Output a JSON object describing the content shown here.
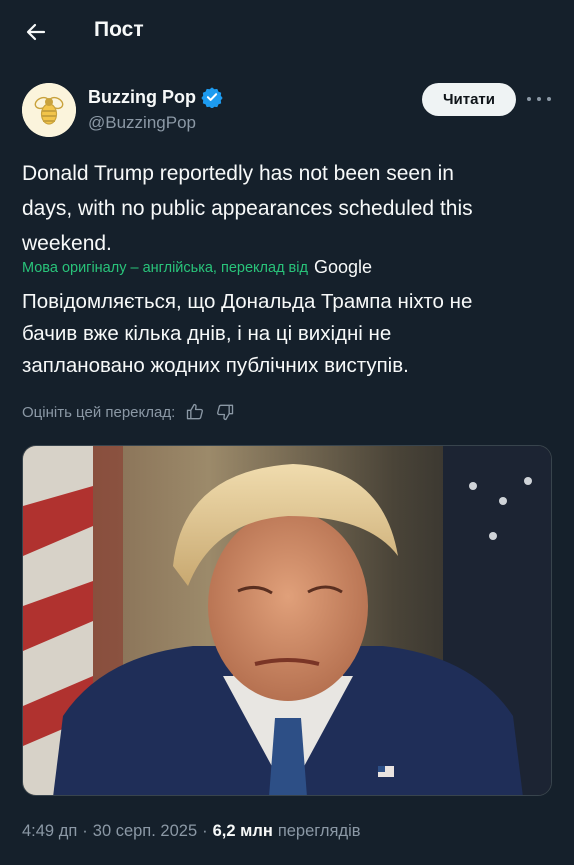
{
  "header": {
    "title": "Пост"
  },
  "author": {
    "name": "Buzzing Pop",
    "handle": "@BuzzingPop",
    "verified": true,
    "follow_label": "Читати"
  },
  "post": {
    "text_lines": [
      "Donald Trump reportedly has not been seen in",
      "days, with no public appearances scheduled this",
      "weekend."
    ],
    "translation_note": "Мова оригіналу – англійська, переклад від",
    "translation_provider": "Google",
    "translated_lines": [
      "Повідомляється, що Дональда Трампа ніхто не",
      "бачив вже кілька днів, і на ці вихідні не",
      "заплановано жодних публічних виступів."
    ],
    "rate_label": "Оцініть цей переклад:"
  },
  "meta": {
    "time": "4:49 дп",
    "date": "30 серп. 2025",
    "views_count": "6,2 млн",
    "views_label": "переглядів",
    "separator": "·"
  },
  "colors": {
    "background": "#15202b",
    "text": "#f7f9f9",
    "secondary": "#8b98a5",
    "accent": "#1d9bf0",
    "translate_green": "#29c37a"
  },
  "icons": {
    "back": "arrow-left-icon",
    "verified": "verified-badge-icon",
    "more": "more-horizontal-icon",
    "thumb_up": "thumb-up-icon",
    "thumb_down": "thumb-down-icon"
  }
}
